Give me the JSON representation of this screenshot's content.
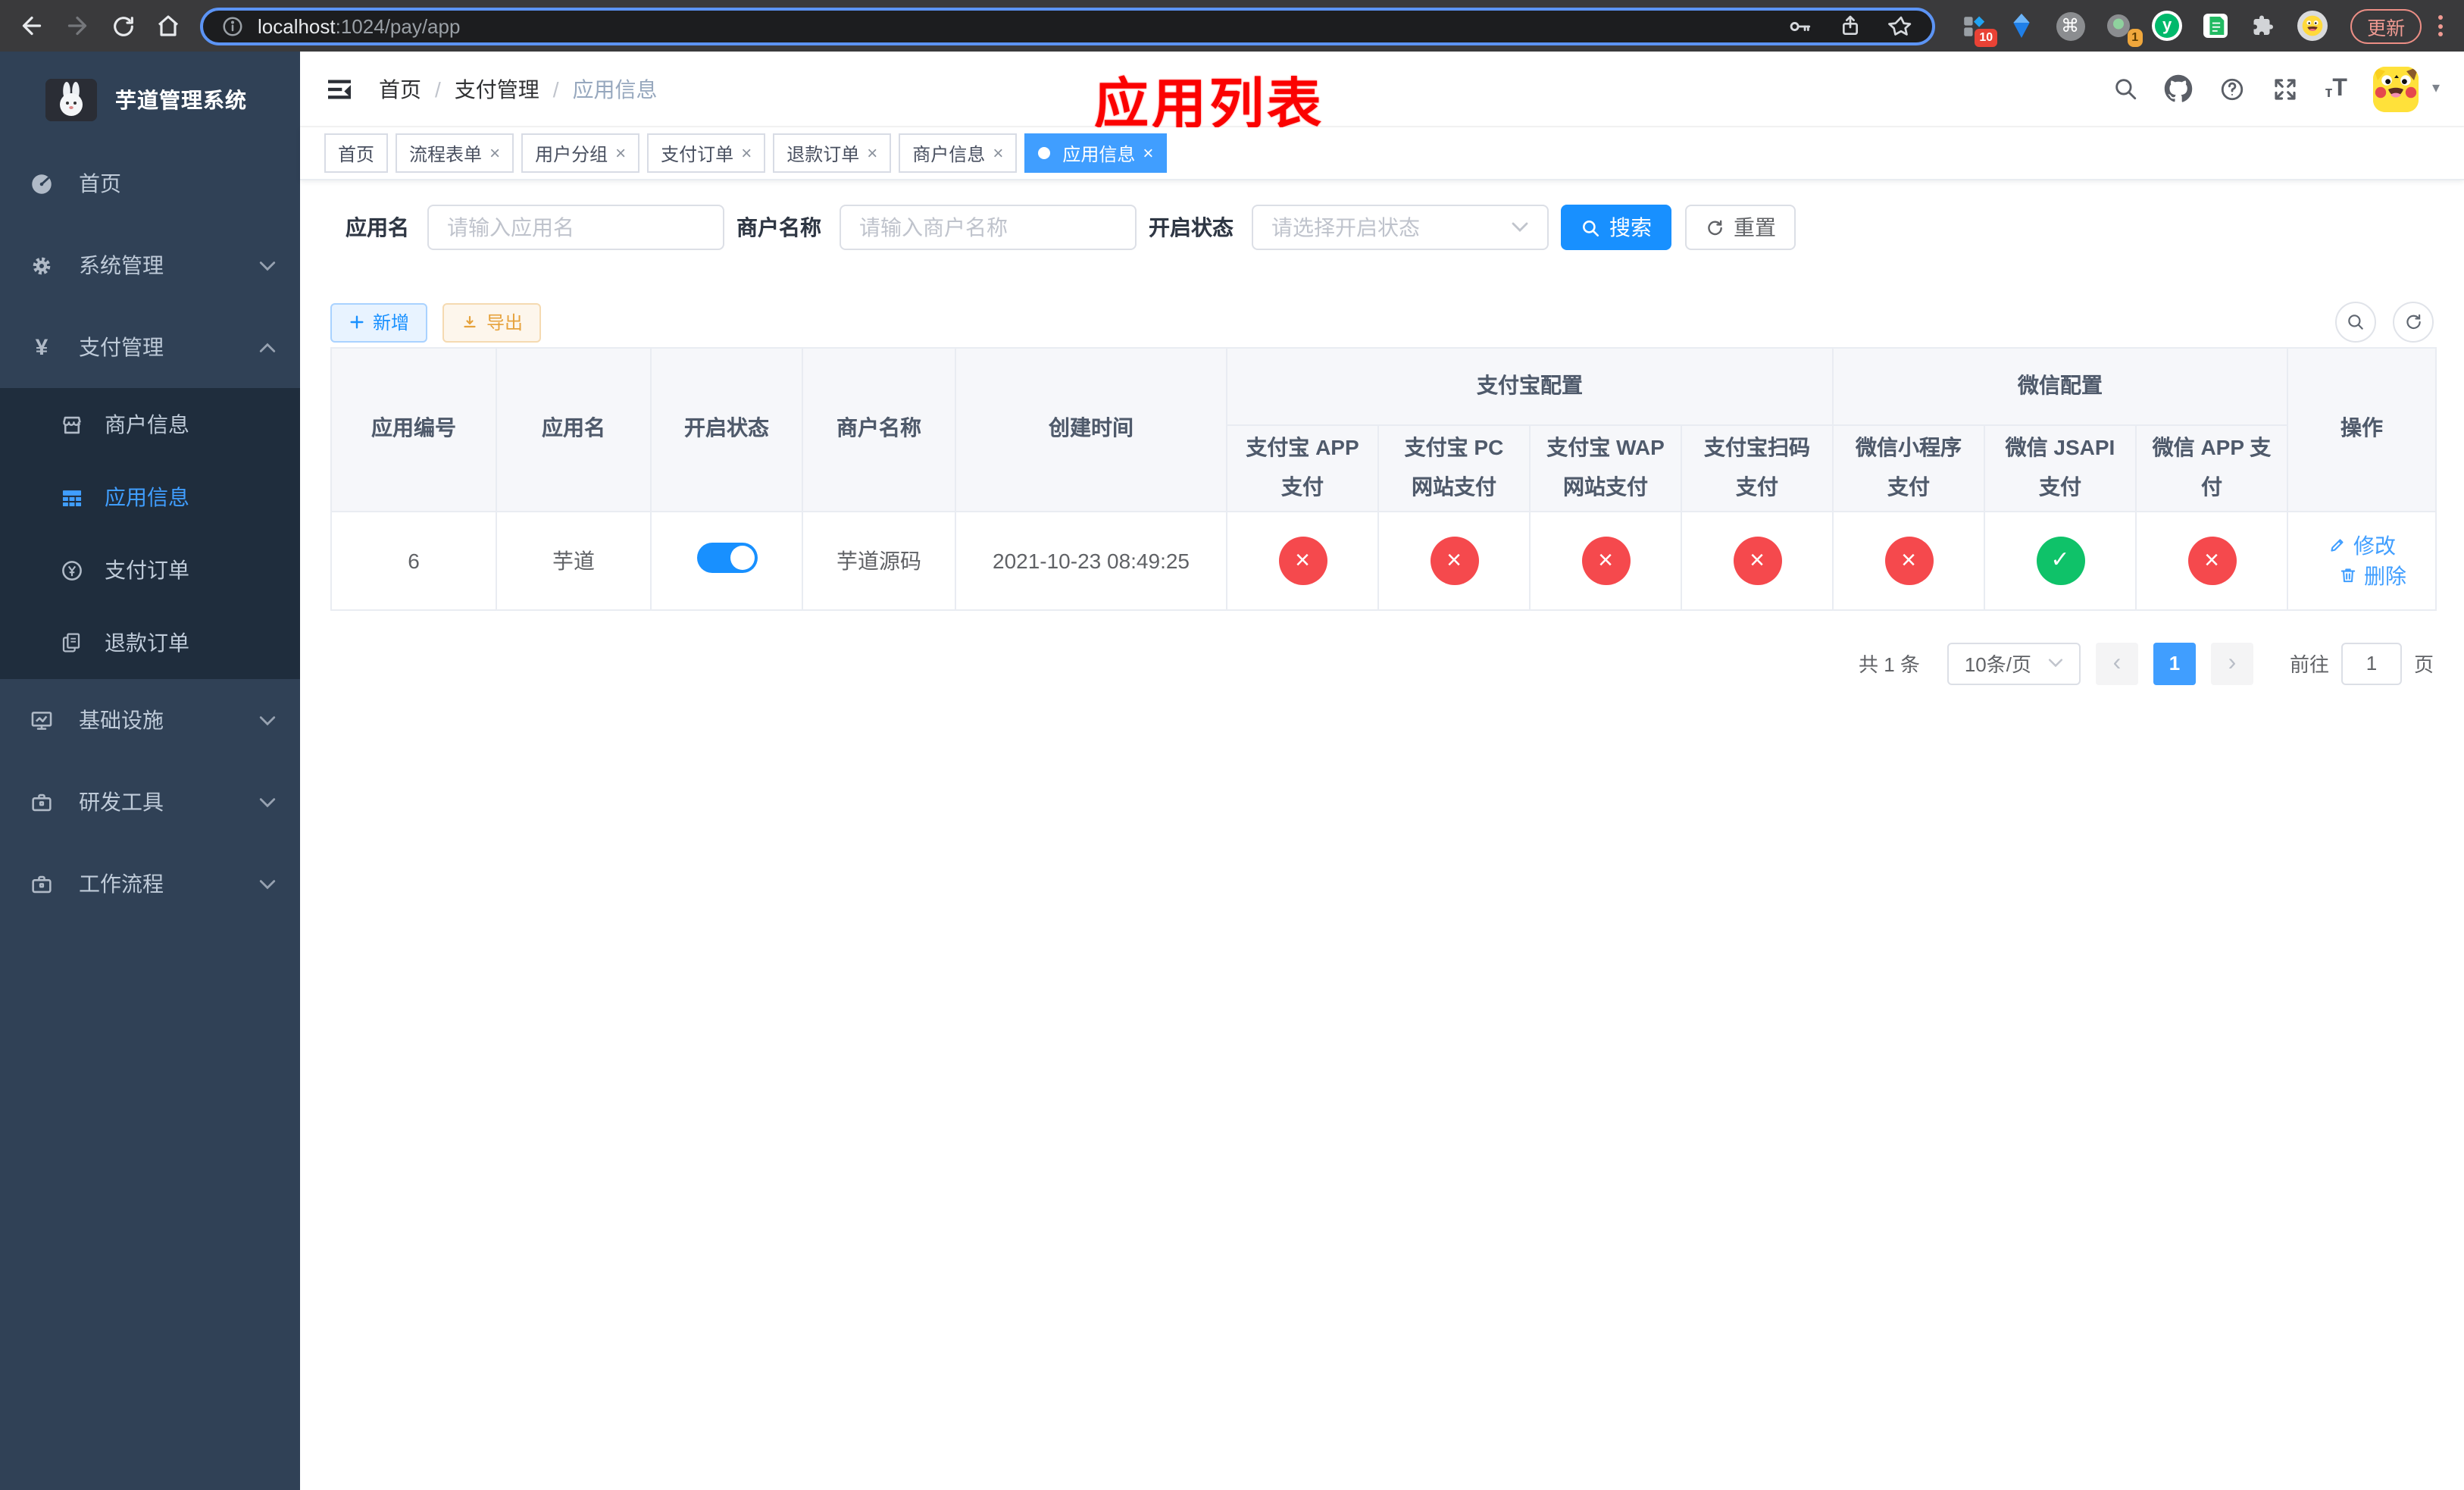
{
  "browser": {
    "url_host": "localhost",
    "url_rest": ":1024/pay/app",
    "update_label": "更新",
    "extension_badges": {
      "grid": "10",
      "proxy": "1"
    }
  },
  "icons": {
    "check": "✓",
    "cross": "×",
    "close": "×",
    "prev": "‹",
    "next": "›",
    "caret_down": "▾",
    "command": "⌘",
    "yuque": "y",
    "yuan": "¥",
    "font_small": "т",
    "font_large": "T"
  },
  "sidebar": {
    "title": "芋道管理系统",
    "items": [
      {
        "label": "首页"
      },
      {
        "label": "系统管理"
      },
      {
        "label": "支付管理"
      },
      {
        "label": "基础设施"
      },
      {
        "label": "研发工具"
      },
      {
        "label": "工作流程"
      }
    ],
    "payment_submenu": [
      {
        "label": "商户信息"
      },
      {
        "label": "应用信息"
      },
      {
        "label": "支付订单"
      },
      {
        "label": "退款订单"
      }
    ]
  },
  "navbar": {
    "breadcrumb": [
      {
        "label": "首页"
      },
      {
        "label": "支付管理"
      },
      {
        "label": "应用信息"
      }
    ],
    "separator": "/"
  },
  "annotation": {
    "text": "应用列表",
    "color": "#fb0201"
  },
  "tabs": [
    {
      "label": "首页"
    },
    {
      "label": "流程表单"
    },
    {
      "label": "用户分组"
    },
    {
      "label": "支付订单"
    },
    {
      "label": "退款订单"
    },
    {
      "label": "商户信息"
    },
    {
      "label": "应用信息"
    }
  ],
  "filters": {
    "app_name_label": "应用名",
    "app_name_placeholder": "请输入应用名",
    "merchant_label": "商户名称",
    "merchant_placeholder": "请输入商户名称",
    "status_label": "开启状态",
    "status_placeholder": "请选择开启状态",
    "search_label": "搜索",
    "reset_label": "重置"
  },
  "toolbar": {
    "add_label": "新增",
    "export_label": "导出"
  },
  "table": {
    "columns": [
      "应用编号",
      "应用名",
      "开启状态",
      "商户名称",
      "创建时间"
    ],
    "groups": [
      {
        "label": "支付宝配置",
        "children": [
          "支付宝 APP 支付",
          "支付宝 PC 网站支付",
          "支付宝 WAP 网站支付",
          "支付宝扫码支付"
        ]
      },
      {
        "label": "微信配置",
        "children": [
          "微信小程序支付",
          "微信 JSAPI 支付",
          "微信 APP 支付"
        ]
      }
    ],
    "actions_label": "操作",
    "row": {
      "id": "6",
      "name": "芋道",
      "enabled": true,
      "merchant": "芋道源码",
      "created": "2021-10-23 08:49:25",
      "pay_status": [
        false,
        false,
        false,
        false,
        false,
        true,
        false
      ],
      "edit_label": "修改",
      "delete_label": "删除"
    }
  },
  "pagination": {
    "total": "共 1 条",
    "page_size": "10条/页",
    "current_page": "1",
    "goto_label": "前往",
    "goto_value": "1",
    "page_unit": "页"
  },
  "colors": {
    "accent": "#409eff",
    "primary_button": "#1890ff",
    "success": "#0fc269",
    "danger": "#f5494d",
    "warning_text": "#e6a23c",
    "sidebar_bg": "#304156",
    "submenu_bg": "#1f2d3d",
    "annotation_red": "#fb0201"
  }
}
